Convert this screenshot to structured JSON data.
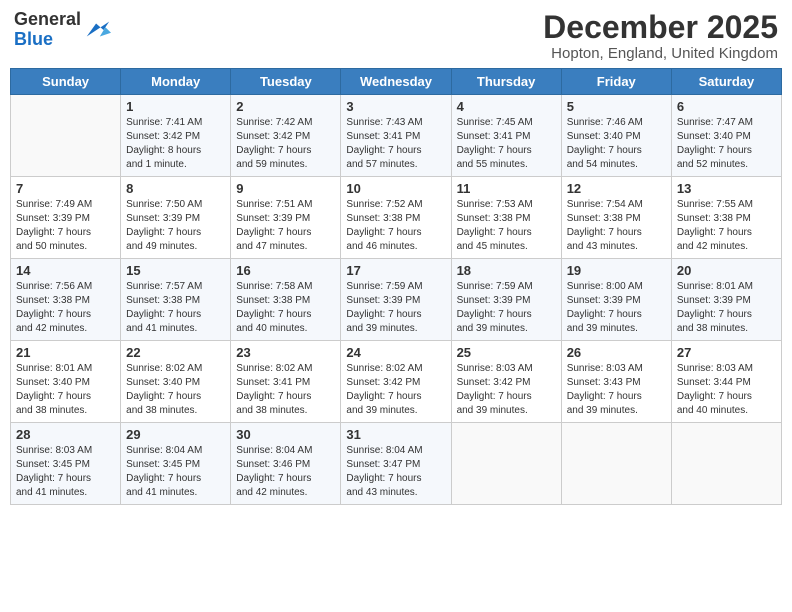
{
  "header": {
    "logo": {
      "line1": "General",
      "line2": "Blue"
    },
    "title": "December 2025",
    "location": "Hopton, England, United Kingdom"
  },
  "days_of_week": [
    "Sunday",
    "Monday",
    "Tuesday",
    "Wednesday",
    "Thursday",
    "Friday",
    "Saturday"
  ],
  "weeks": [
    [
      {
        "day": "",
        "info": ""
      },
      {
        "day": "1",
        "info": "Sunrise: 7:41 AM\nSunset: 3:42 PM\nDaylight: 8 hours\nand 1 minute."
      },
      {
        "day": "2",
        "info": "Sunrise: 7:42 AM\nSunset: 3:42 PM\nDaylight: 7 hours\nand 59 minutes."
      },
      {
        "day": "3",
        "info": "Sunrise: 7:43 AM\nSunset: 3:41 PM\nDaylight: 7 hours\nand 57 minutes."
      },
      {
        "day": "4",
        "info": "Sunrise: 7:45 AM\nSunset: 3:41 PM\nDaylight: 7 hours\nand 55 minutes."
      },
      {
        "day": "5",
        "info": "Sunrise: 7:46 AM\nSunset: 3:40 PM\nDaylight: 7 hours\nand 54 minutes."
      },
      {
        "day": "6",
        "info": "Sunrise: 7:47 AM\nSunset: 3:40 PM\nDaylight: 7 hours\nand 52 minutes."
      }
    ],
    [
      {
        "day": "7",
        "info": "Sunrise: 7:49 AM\nSunset: 3:39 PM\nDaylight: 7 hours\nand 50 minutes."
      },
      {
        "day": "8",
        "info": "Sunrise: 7:50 AM\nSunset: 3:39 PM\nDaylight: 7 hours\nand 49 minutes."
      },
      {
        "day": "9",
        "info": "Sunrise: 7:51 AM\nSunset: 3:39 PM\nDaylight: 7 hours\nand 47 minutes."
      },
      {
        "day": "10",
        "info": "Sunrise: 7:52 AM\nSunset: 3:38 PM\nDaylight: 7 hours\nand 46 minutes."
      },
      {
        "day": "11",
        "info": "Sunrise: 7:53 AM\nSunset: 3:38 PM\nDaylight: 7 hours\nand 45 minutes."
      },
      {
        "day": "12",
        "info": "Sunrise: 7:54 AM\nSunset: 3:38 PM\nDaylight: 7 hours\nand 43 minutes."
      },
      {
        "day": "13",
        "info": "Sunrise: 7:55 AM\nSunset: 3:38 PM\nDaylight: 7 hours\nand 42 minutes."
      }
    ],
    [
      {
        "day": "14",
        "info": "Sunrise: 7:56 AM\nSunset: 3:38 PM\nDaylight: 7 hours\nand 42 minutes."
      },
      {
        "day": "15",
        "info": "Sunrise: 7:57 AM\nSunset: 3:38 PM\nDaylight: 7 hours\nand 41 minutes."
      },
      {
        "day": "16",
        "info": "Sunrise: 7:58 AM\nSunset: 3:38 PM\nDaylight: 7 hours\nand 40 minutes."
      },
      {
        "day": "17",
        "info": "Sunrise: 7:59 AM\nSunset: 3:39 PM\nDaylight: 7 hours\nand 39 minutes."
      },
      {
        "day": "18",
        "info": "Sunrise: 7:59 AM\nSunset: 3:39 PM\nDaylight: 7 hours\nand 39 minutes."
      },
      {
        "day": "19",
        "info": "Sunrise: 8:00 AM\nSunset: 3:39 PM\nDaylight: 7 hours\nand 39 minutes."
      },
      {
        "day": "20",
        "info": "Sunrise: 8:01 AM\nSunset: 3:39 PM\nDaylight: 7 hours\nand 38 minutes."
      }
    ],
    [
      {
        "day": "21",
        "info": "Sunrise: 8:01 AM\nSunset: 3:40 PM\nDaylight: 7 hours\nand 38 minutes."
      },
      {
        "day": "22",
        "info": "Sunrise: 8:02 AM\nSunset: 3:40 PM\nDaylight: 7 hours\nand 38 minutes."
      },
      {
        "day": "23",
        "info": "Sunrise: 8:02 AM\nSunset: 3:41 PM\nDaylight: 7 hours\nand 38 minutes."
      },
      {
        "day": "24",
        "info": "Sunrise: 8:02 AM\nSunset: 3:42 PM\nDaylight: 7 hours\nand 39 minutes."
      },
      {
        "day": "25",
        "info": "Sunrise: 8:03 AM\nSunset: 3:42 PM\nDaylight: 7 hours\nand 39 minutes."
      },
      {
        "day": "26",
        "info": "Sunrise: 8:03 AM\nSunset: 3:43 PM\nDaylight: 7 hours\nand 39 minutes."
      },
      {
        "day": "27",
        "info": "Sunrise: 8:03 AM\nSunset: 3:44 PM\nDaylight: 7 hours\nand 40 minutes."
      }
    ],
    [
      {
        "day": "28",
        "info": "Sunrise: 8:03 AM\nSunset: 3:45 PM\nDaylight: 7 hours\nand 41 minutes."
      },
      {
        "day": "29",
        "info": "Sunrise: 8:04 AM\nSunset: 3:45 PM\nDaylight: 7 hours\nand 41 minutes."
      },
      {
        "day": "30",
        "info": "Sunrise: 8:04 AM\nSunset: 3:46 PM\nDaylight: 7 hours\nand 42 minutes."
      },
      {
        "day": "31",
        "info": "Sunrise: 8:04 AM\nSunset: 3:47 PM\nDaylight: 7 hours\nand 43 minutes."
      },
      {
        "day": "",
        "info": ""
      },
      {
        "day": "",
        "info": ""
      },
      {
        "day": "",
        "info": ""
      }
    ]
  ]
}
